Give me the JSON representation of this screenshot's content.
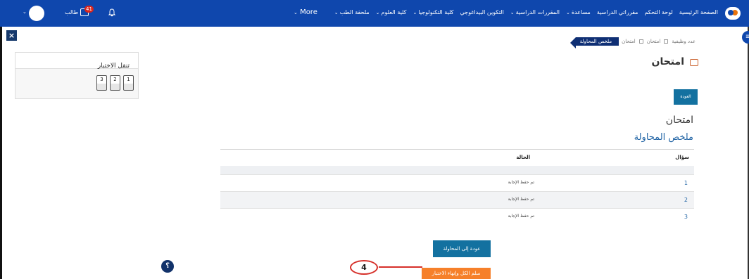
{
  "navbar": {
    "menu": [
      {
        "label": "الصفحة الرئيسية",
        "caret": false
      },
      {
        "label": "لوحة التحكم",
        "caret": false
      },
      {
        "label": "مقرراتي الدراسية",
        "caret": false
      },
      {
        "label": "مساعدة",
        "caret": true
      },
      {
        "label": "المقررات الدراسية",
        "caret": true
      },
      {
        "label": "التكوين البيداغوجي",
        "caret": false
      },
      {
        "label": "كلية التكنولوجيا",
        "caret": true
      },
      {
        "label": "كلية العلوم",
        "caret": true
      },
      {
        "label": "ملحقة الطب",
        "caret": true
      }
    ],
    "more_label": "More",
    "user_name": "طالب",
    "message_badge": "41",
    "caret_glyph": "⌄"
  },
  "drawer": {
    "close_glyph": "×",
    "nav_title": "تنقل الاختبار",
    "questions": [
      "1",
      "2",
      "3"
    ]
  },
  "help_glyph": "؟",
  "toggle_glyph": "≡",
  "breadcrumb": [
    "عدد وظيفية",
    "امتحان",
    "امتحان"
  ],
  "breadcrumb_active": "ملخص المحاولة",
  "page_title": "امتحان",
  "back_button": "العودة",
  "quiz_name": "امتحان",
  "summary_title": "ملخص المحاولة",
  "table": {
    "col_question": "سؤال",
    "col_status": "الحالة",
    "rows": [
      {
        "num": "1",
        "status": "تم حفظ الإجابة"
      },
      {
        "num": "2",
        "status": "تم حفظ الإجابة"
      },
      {
        "num": "3",
        "status": "تم حفظ الإجابة"
      }
    ]
  },
  "return_button": "عودة إلى المحاولة",
  "submit_button": "سلم الكل وإنهاء الاختبار",
  "annotation": "4",
  "colors": {
    "navbar": "#0f47ad",
    "primary_button": "#1371a0",
    "submit_button": "#f6802a",
    "annotation": "#d6302a",
    "link": "#2466a6"
  }
}
